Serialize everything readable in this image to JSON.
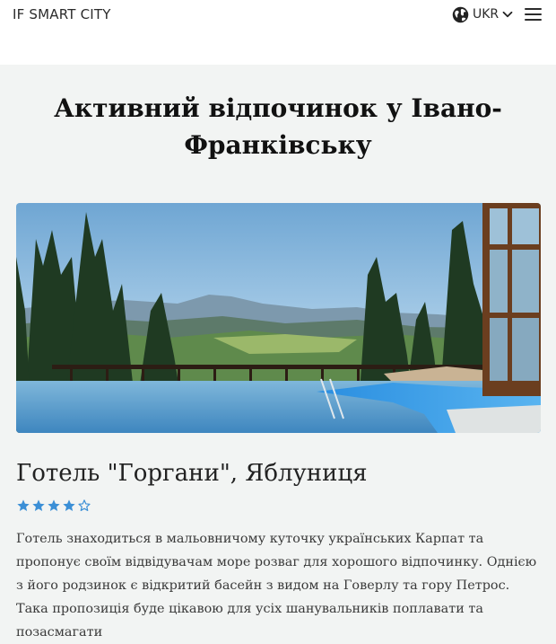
{
  "header": {
    "brand": "IF SMART CITY",
    "language": "UKR",
    "globe_icon": "globe-icon",
    "chevron_icon": "chevron-down-icon",
    "menu_icon": "hamburger-menu-icon"
  },
  "page": {
    "title": "Активний відпочинок у Івано-Франківську"
  },
  "hotel": {
    "name": "Готель \"Горгани\", Яблуниця",
    "rating": 4,
    "rating_max": 5,
    "image_alt": "mountain-infinity-pool-photo",
    "description": "Готель знаходиться в мальовничому куточку українських Карпат та пропонує своїм відвідувачам море розваг для хорошого відпочинку. Однією з його родзинок є відкритий басейн з видом на Говерлу та гору Петрос. Така пропозиція буде цікавою для усіх шанувальників поплавати та позасмагати"
  },
  "colors": {
    "background": "#f2f4f3",
    "header": "#ffffff",
    "star": "#3b8fd6",
    "text": "#3a3a3a"
  }
}
